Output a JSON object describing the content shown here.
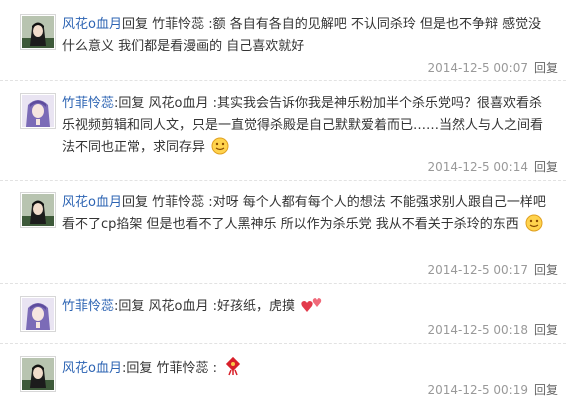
{
  "replies": [
    {
      "user": "风花o血月",
      "text": "回复 竹菲怜蕊 :额 各自有各自的见解吧 不认同杀玲 但是也不争辩 感觉没什么意义 我们都是看漫画的 自己喜欢就好",
      "time": "2014-12-5 00:07",
      "reply": "回复",
      "avatar": "dark-hair-avatar"
    },
    {
      "user": "竹菲怜蕊",
      "text": ":回复 风花o血月 :其实我会告诉你我是神乐粉加半个杀乐党吗？很喜欢看杀乐视频剪辑和同人文，只是一直觉得杀殿是自己默默爱着而已……当然人与人之间看法不同也正常，求同存异",
      "emoji": "smile-emoji",
      "time": "2014-12-5 00:14",
      "reply": "回复",
      "avatar": "purple-hair-avatar"
    },
    {
      "user": "风花o血月",
      "text": "回复 竹菲怜蕊 :对呀 每个人都有每个人的想法 不能强求别人跟自己一样吧 看不了cp掐架 但是也看不了人黑神乐 所以作为杀乐党 我从不看关于杀玲的东西",
      "emoji": "smile-emoji",
      "time": "2014-12-5 00:17",
      "reply": "回复",
      "avatar": "dark-hair-avatar"
    },
    {
      "user": "竹菲怜蕊",
      "text": ":回复 风花o血月 :好孩纸，虎摸",
      "emoji": "hearts-emoji",
      "time": "2014-12-5 00:18",
      "reply": "回复",
      "avatar": "purple-hair-avatar"
    },
    {
      "user": "风花o血月",
      "text": ":回复 竹菲怜蕊 :",
      "emoji": "chinese-knot-emoji",
      "time": "2014-12-5 00:19",
      "reply": "回复",
      "avatar": "dark-hair-avatar"
    }
  ]
}
